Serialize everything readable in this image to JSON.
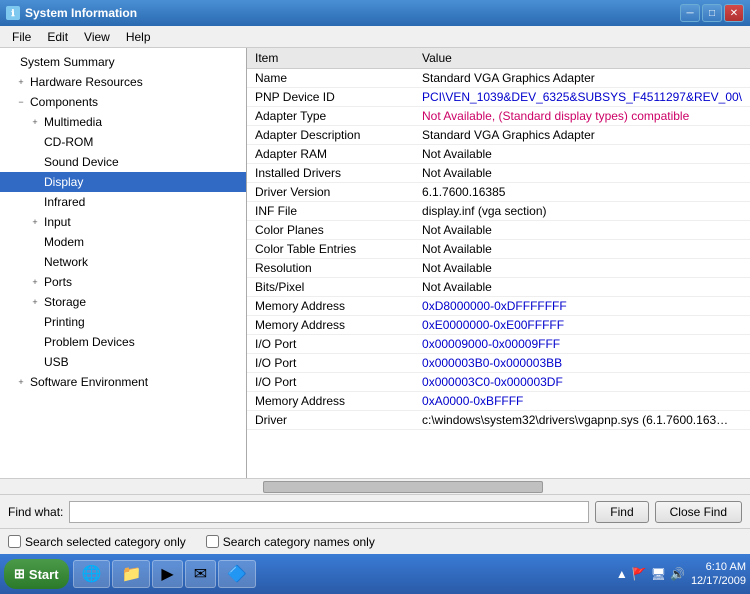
{
  "titleBar": {
    "title": "System Information",
    "minLabel": "─",
    "maxLabel": "□",
    "closeLabel": "✕"
  },
  "menuBar": {
    "items": [
      "File",
      "Edit",
      "View",
      "Help"
    ]
  },
  "tree": {
    "items": [
      {
        "id": "system-summary",
        "label": "System Summary",
        "indent": 0,
        "expander": ""
      },
      {
        "id": "hardware-resources",
        "label": "Hardware Resources",
        "indent": 1,
        "expander": "+"
      },
      {
        "id": "components",
        "label": "Components",
        "indent": 1,
        "expander": "−"
      },
      {
        "id": "multimedia",
        "label": "Multimedia",
        "indent": 2,
        "expander": "+"
      },
      {
        "id": "cd-rom",
        "label": "CD-ROM",
        "indent": 2,
        "expander": ""
      },
      {
        "id": "sound-device",
        "label": "Sound Device",
        "indent": 2,
        "expander": ""
      },
      {
        "id": "display",
        "label": "Display",
        "indent": 2,
        "expander": "",
        "selected": true
      },
      {
        "id": "infrared",
        "label": "Infrared",
        "indent": 2,
        "expander": ""
      },
      {
        "id": "input",
        "label": "Input",
        "indent": 2,
        "expander": "+"
      },
      {
        "id": "modem",
        "label": "Modem",
        "indent": 2,
        "expander": ""
      },
      {
        "id": "network",
        "label": "Network",
        "indent": 2,
        "expander": ""
      },
      {
        "id": "ports",
        "label": "Ports",
        "indent": 2,
        "expander": "+"
      },
      {
        "id": "storage",
        "label": "Storage",
        "indent": 2,
        "expander": "+"
      },
      {
        "id": "printing",
        "label": "Printing",
        "indent": 2,
        "expander": ""
      },
      {
        "id": "problem-devices",
        "label": "Problem Devices",
        "indent": 2,
        "expander": ""
      },
      {
        "id": "usb",
        "label": "USB",
        "indent": 2,
        "expander": ""
      },
      {
        "id": "software-environment",
        "label": "Software Environment",
        "indent": 1,
        "expander": "+"
      }
    ]
  },
  "detail": {
    "columns": [
      "Item",
      "Value"
    ],
    "rows": [
      {
        "item": "Name",
        "value": "Standard VGA Graphics Adapter",
        "valClass": ""
      },
      {
        "item": "PNP Device ID",
        "value": "PCI\\VEN_1039&DEV_6325&SUBSYS_F4511297&REV_00\\",
        "valClass": "val-blue"
      },
      {
        "item": "Adapter Type",
        "value": "Not Available, (Standard display types) compatible",
        "valClass": "val-pink"
      },
      {
        "item": "Adapter Description",
        "value": "Standard VGA Graphics Adapter",
        "valClass": ""
      },
      {
        "item": "Adapter RAM",
        "value": "Not Available",
        "valClass": ""
      },
      {
        "item": "Installed Drivers",
        "value": "Not Available",
        "valClass": ""
      },
      {
        "item": "Driver Version",
        "value": "6.1.7600.16385",
        "valClass": ""
      },
      {
        "item": "INF File",
        "value": "display.inf (vga section)",
        "valClass": ""
      },
      {
        "item": "Color Planes",
        "value": "Not Available",
        "valClass": ""
      },
      {
        "item": "Color Table Entries",
        "value": "Not Available",
        "valClass": ""
      },
      {
        "item": "Resolution",
        "value": "Not Available",
        "valClass": ""
      },
      {
        "item": "Bits/Pixel",
        "value": "Not Available",
        "valClass": ""
      },
      {
        "item": "Memory Address",
        "value": "0xD8000000-0xDFFFFFFF",
        "valClass": "val-blue"
      },
      {
        "item": "Memory Address",
        "value": "0xE0000000-0xE00FFFFF",
        "valClass": "val-blue"
      },
      {
        "item": "I/O Port",
        "value": "0x00009000-0x00009FFF",
        "valClass": "val-blue"
      },
      {
        "item": "I/O Port",
        "value": "0x000003B0-0x000003BB",
        "valClass": "val-blue"
      },
      {
        "item": "I/O Port",
        "value": "0x000003C0-0x000003DF",
        "valClass": "val-blue"
      },
      {
        "item": "Memory Address",
        "value": "0xA0000-0xBFFFF",
        "valClass": "val-blue"
      },
      {
        "item": "Driver",
        "value": "c:\\windows\\system32\\drivers\\vgapnp.sys (6.1.7600.163…",
        "valClass": ""
      }
    ]
  },
  "findBar": {
    "label": "Find what:",
    "placeholder": "",
    "findBtn": "Find",
    "closeFindBtn": "Close Find"
  },
  "searchOpts": {
    "opt1": "Search selected category only",
    "opt2": "Search category names only"
  },
  "taskbar": {
    "startLabel": "Start",
    "time": "6:10 AM",
    "date": "12/17/2009"
  }
}
